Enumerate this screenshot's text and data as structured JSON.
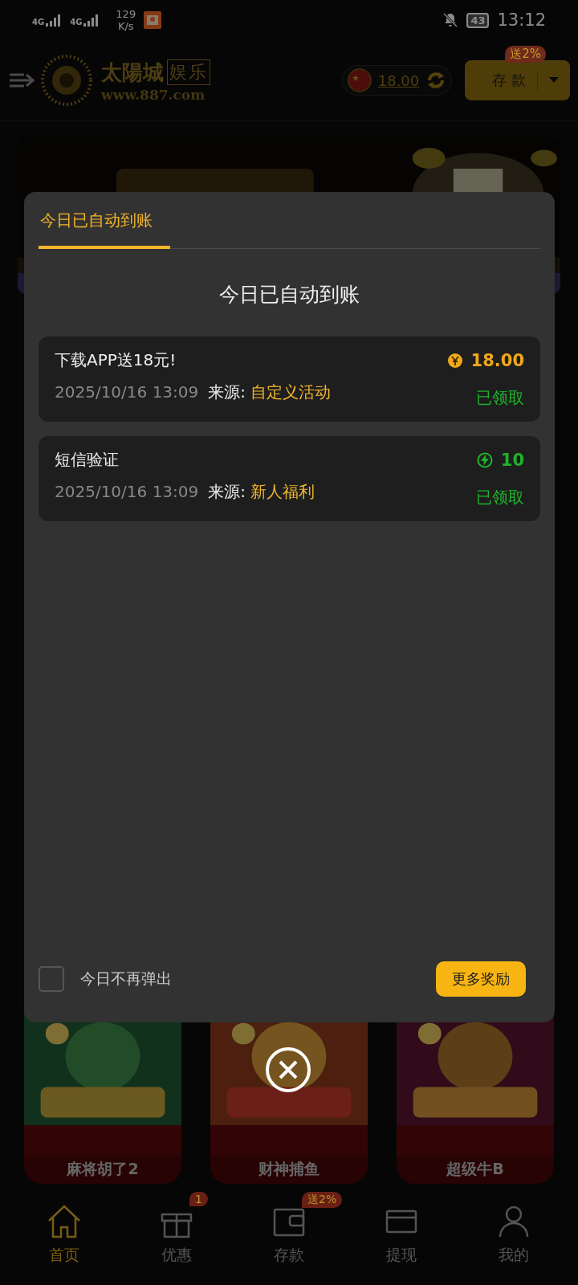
{
  "status_bar": {
    "networks": [
      "4G",
      "4G"
    ],
    "speed": "129",
    "speed_unit": "K/s",
    "battery": "43",
    "time": "13:12"
  },
  "header": {
    "logo_name": "太陽城",
    "logo_suffix": "娱乐",
    "logo_site": "www.887.com",
    "balance": "18.00",
    "deposit_button": "存 款",
    "deposit_badge": "送2%"
  },
  "games": [
    {
      "name": "麻将胡了2"
    },
    {
      "name": "财神捕鱼"
    },
    {
      "name": "超级牛B"
    }
  ],
  "bottom_nav": [
    {
      "label": "首页",
      "selected": true
    },
    {
      "label": "优惠",
      "selected": false,
      "badge": "1"
    },
    {
      "label": "存款",
      "selected": false,
      "badge": "送2%"
    },
    {
      "label": "提现",
      "selected": false
    },
    {
      "label": "我的",
      "selected": false
    }
  ],
  "modal": {
    "tabs": [
      {
        "label": "今日已自动到账",
        "selected": true
      }
    ],
    "title": "今日已自动到账",
    "records": [
      {
        "title": "下载APP送18元!",
        "kind": "coin",
        "amount": "18.00",
        "time": "2025/10/16 13:09",
        "source_label": "来源:",
        "source": "自定义活动",
        "status": "已领取"
      },
      {
        "title": "短信验证",
        "kind": "bolt",
        "amount": "10",
        "time": "2025/10/16 13:09",
        "source_label": "来源:",
        "source": "新人福利",
        "status": "已领取"
      }
    ],
    "dont_show_today": {
      "label": "今日不再弹出",
      "checked": false
    },
    "more_button": "更多奖励"
  }
}
